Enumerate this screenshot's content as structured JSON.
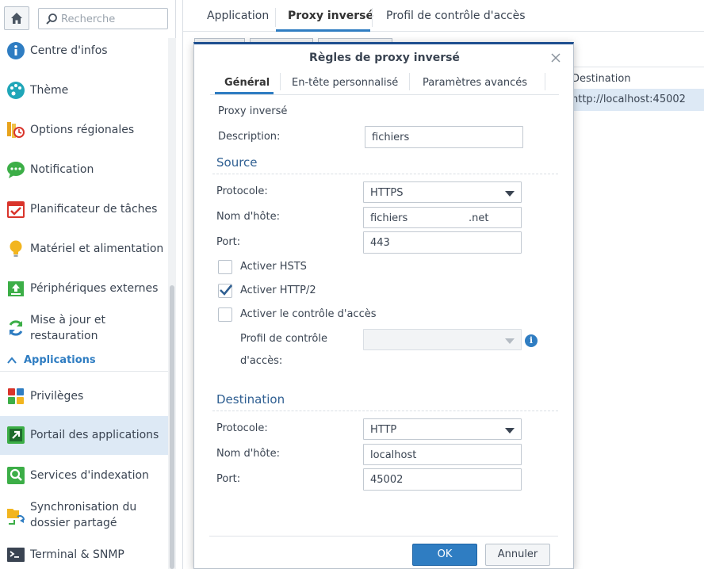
{
  "search": {
    "placeholder": "Recherche"
  },
  "sidebar": {
    "items": [
      {
        "label": "Centre d'infos",
        "icon": "info-icon"
      },
      {
        "label": "Thème",
        "icon": "palette-icon"
      },
      {
        "label": "Options régionales",
        "icon": "regional-options-icon"
      },
      {
        "label": "Notification",
        "icon": "chat-bubble-icon"
      },
      {
        "label": "Planificateur de tâches",
        "icon": "calendar-check-icon"
      },
      {
        "label": "Matériel et alimentation",
        "icon": "lightbulb-icon"
      },
      {
        "label": "Périphériques externes",
        "icon": "external-device-icon"
      },
      {
        "label": "Mise à jour et",
        "label2": "restauration",
        "icon": "refresh-icon"
      }
    ],
    "section": {
      "label": "Applications"
    },
    "apps": [
      {
        "label": "Privilèges",
        "icon": "privileges-icon"
      },
      {
        "label": "Portail des applications",
        "icon": "app-portal-icon",
        "active": true
      },
      {
        "label": "Services d'indexation",
        "icon": "indexing-search-icon"
      },
      {
        "label": "Synchronisation du",
        "label2": "dossier partagé",
        "icon": "shared-folder-sync-icon"
      },
      {
        "label": "Terminal & SNMP",
        "icon": "terminal-icon"
      }
    ]
  },
  "main": {
    "tabs": [
      "Application",
      "Proxy inversé",
      "Profil de contrôle d'accès"
    ],
    "grid": {
      "header": "Destination",
      "row": "http://localhost:45002"
    }
  },
  "dialog": {
    "title": "Règles de proxy inversé",
    "tabs": [
      "Général",
      "En-tête personnalisé",
      "Paramètres avancés"
    ],
    "proxy_label": "Proxy inversé",
    "description_label": "Description:",
    "description_value": "fichiers",
    "source": {
      "title": "Source",
      "protocol_label": "Protocole:",
      "protocol_value": "HTTPS",
      "hostname_label": "Nom d'hôte:",
      "hostname_value": "fichiers",
      "hostname_suffix": ".net",
      "port_label": "Port:",
      "port_value": "443",
      "hsts_label": "Activer HSTS",
      "hsts_checked": false,
      "http2_label": "Activer HTTP/2",
      "http2_checked": true,
      "access_control_label": "Activer le contrôle d'accès",
      "access_control_checked": false,
      "profile_label_1": "Profil de contrôle",
      "profile_label_2": "d'accès:",
      "profile_value": ""
    },
    "destination": {
      "title": "Destination",
      "protocol_label": "Protocole:",
      "protocol_value": "HTTP",
      "hostname_label": "Nom d'hôte:",
      "hostname_value": "localhost",
      "port_label": "Port:",
      "port_value": "45002"
    },
    "ok_label": "OK",
    "cancel_label": "Annuler"
  },
  "colors": {
    "accent": "#2f7dc2",
    "dialog_border_top": "#1e4f8f",
    "selection": "#dde9f5"
  }
}
